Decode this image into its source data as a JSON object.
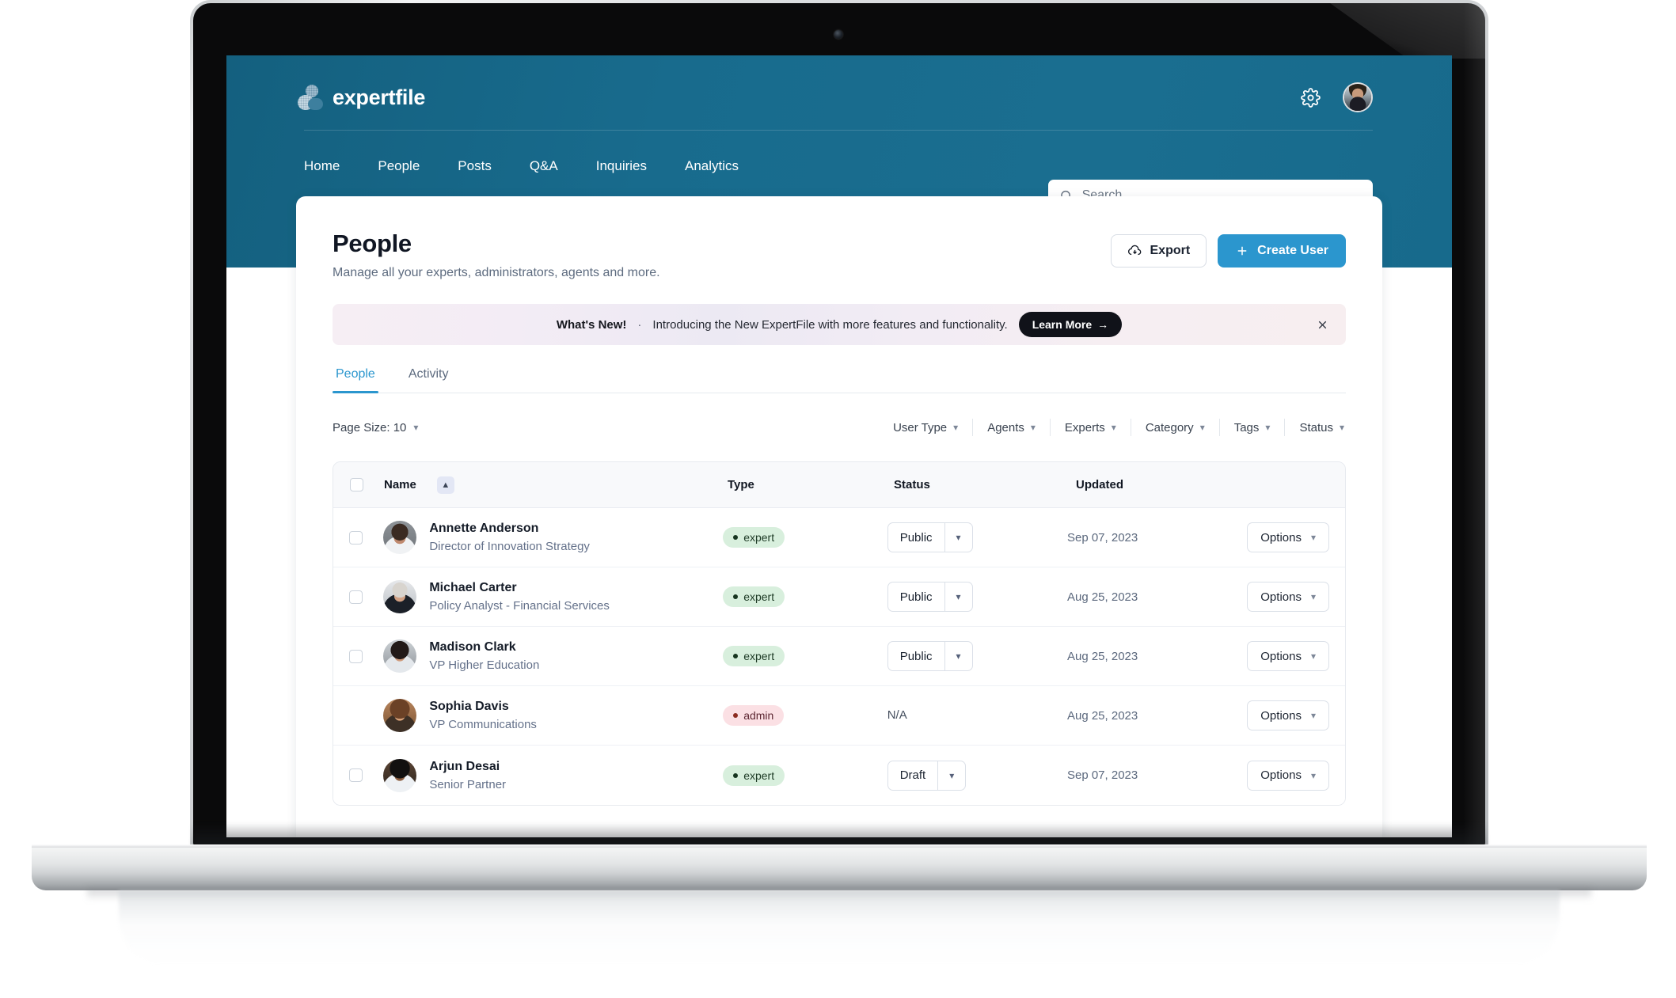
{
  "brand": {
    "name": "expertfile"
  },
  "header": {
    "nav": [
      {
        "label": "Home"
      },
      {
        "label": "People"
      },
      {
        "label": "Posts"
      },
      {
        "label": "Q&A"
      },
      {
        "label": "Inquiries"
      },
      {
        "label": "Analytics"
      }
    ],
    "settings_icon": "gear-icon",
    "avatar_icon": "user-avatar"
  },
  "search": {
    "placeholder": "Search",
    "value": "",
    "icon": "search-icon"
  },
  "page": {
    "title": "People",
    "subtitle": "Manage all your experts, administrators, agents and more.",
    "export_label": "Export",
    "export_icon": "cloud-download-icon",
    "create_label": "Create User",
    "create_icon": "plus-icon"
  },
  "banner": {
    "strong": "What's New!",
    "separator": "·",
    "text": "Introducing the New ExpertFile with more features and functionality.",
    "cta_label": "Learn More",
    "cta_arrow": "→",
    "close_icon": "close-icon"
  },
  "tabs": [
    {
      "label": "People",
      "active": true
    },
    {
      "label": "Activity",
      "active": false
    }
  ],
  "filters": {
    "page_size_label": "Page Size: 10",
    "items": [
      {
        "label": "User Type"
      },
      {
        "label": "Agents"
      },
      {
        "label": "Experts"
      },
      {
        "label": "Category"
      },
      {
        "label": "Tags"
      },
      {
        "label": "Status"
      }
    ]
  },
  "table": {
    "columns": {
      "name": "Name",
      "type": "Type",
      "status": "Status",
      "updated": "Updated"
    },
    "sort": {
      "column": "Name",
      "direction": "asc",
      "icon": "chevron-up-icon"
    },
    "options_label": "Options",
    "rows": [
      {
        "name": "Annette Anderson",
        "role": "Director of Innovation Strategy",
        "type": "expert",
        "status": "Public",
        "has_status_dropdown": true,
        "updated": "Sep 07, 2023",
        "has_checkbox": true
      },
      {
        "name": "Michael Carter",
        "role": "Policy Analyst - Financial Services",
        "type": "expert",
        "status": "Public",
        "has_status_dropdown": true,
        "updated": "Aug 25, 2023",
        "has_checkbox": true
      },
      {
        "name": "Madison Clark",
        "role": "VP Higher Education",
        "type": "expert",
        "status": "Public",
        "has_status_dropdown": true,
        "updated": "Aug 25, 2023",
        "has_checkbox": true
      },
      {
        "name": "Sophia Davis",
        "role": "VP Communications",
        "type": "admin",
        "status": "N/A",
        "has_status_dropdown": false,
        "updated": "Aug 25, 2023",
        "has_checkbox": false
      },
      {
        "name": "Arjun Desai",
        "role": "Senior Partner",
        "type": "expert",
        "status": "Draft",
        "has_status_dropdown": true,
        "updated": "Sep 07, 2023",
        "has_checkbox": true
      }
    ]
  },
  "colors": {
    "header_blue": "#186b8d",
    "accent_blue": "#2b96ce",
    "expert_green_bg": "#d8efdd",
    "admin_pink_bg": "#fbe0e4",
    "dark_button": "#101219"
  }
}
